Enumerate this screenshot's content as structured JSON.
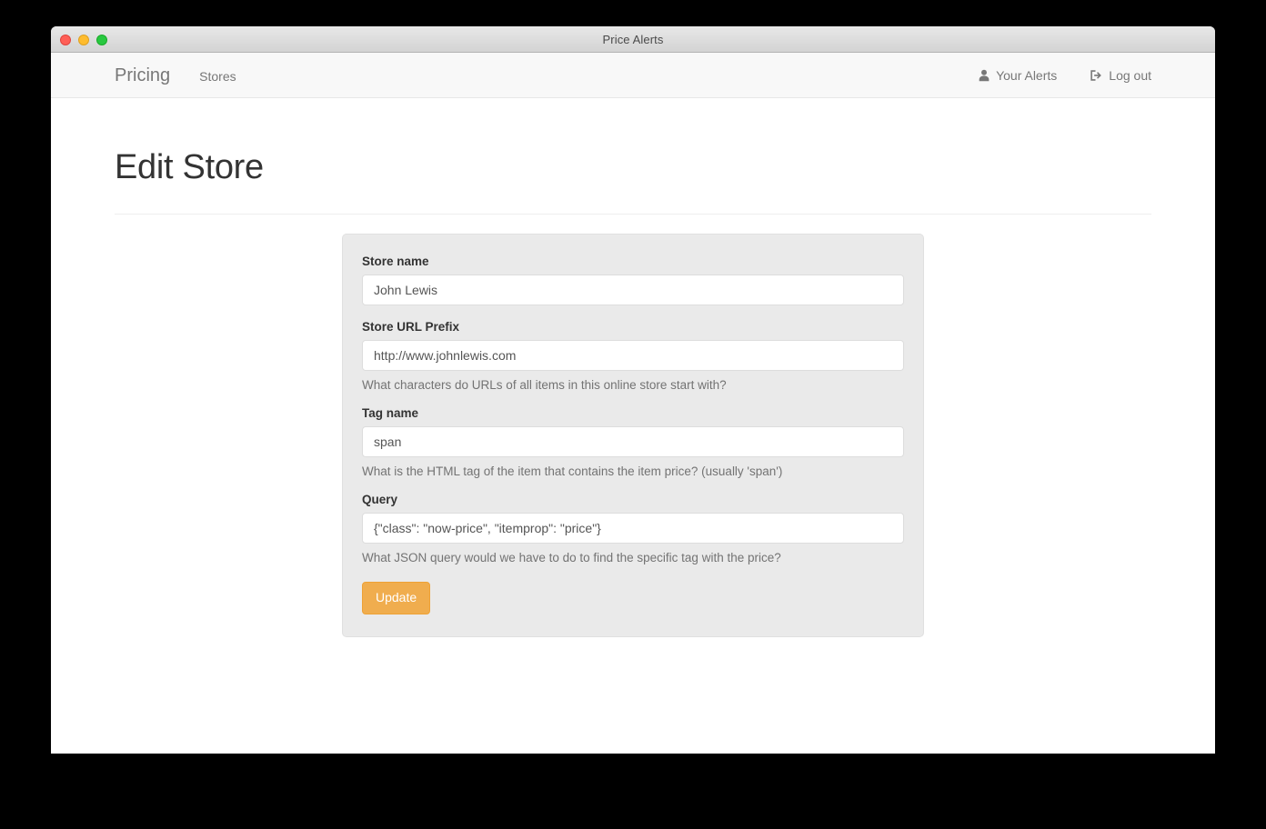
{
  "window": {
    "title": "Price Alerts",
    "traffic_lights": [
      {
        "name": "close",
        "color": "#ff5f57"
      },
      {
        "name": "minimize",
        "color": "#febc2e"
      },
      {
        "name": "maximize",
        "color": "#28c840"
      }
    ]
  },
  "navbar": {
    "brand": "Pricing",
    "links": [
      {
        "label": "Stores"
      }
    ],
    "right_items": [
      {
        "label": "Your Alerts",
        "icon": "user-icon"
      },
      {
        "label": "Log out",
        "icon": "sign-out-icon"
      }
    ]
  },
  "main": {
    "page_title": "Edit Store",
    "form": {
      "fields": [
        {
          "label": "Store name",
          "value": "John Lewis",
          "placeholder": "Store name",
          "help": ""
        },
        {
          "label": "Store URL Prefix",
          "value": "http://www.johnlewis.com",
          "placeholder": "Store URL Prefix",
          "help": "What characters do URLs of all items in this online store start with?"
        },
        {
          "label": "Tag name",
          "value": "span",
          "placeholder": "Tag name",
          "help": "What is the HTML tag of the item that contains the item price? (usually 'span')"
        },
        {
          "label": "Query",
          "value": "{\"class\": \"now-price\", \"itemprop\": \"price\"}",
          "placeholder": "Query",
          "help": "What JSON query would we have to do to find the specific tag with the price?"
        }
      ],
      "submit_label": "Update"
    }
  },
  "colors": {
    "accent": "#f0ad4e",
    "panel_bg": "#eaeaea",
    "navbar_bg": "#f8f8f8",
    "text": "#333333",
    "muted": "#777777"
  }
}
